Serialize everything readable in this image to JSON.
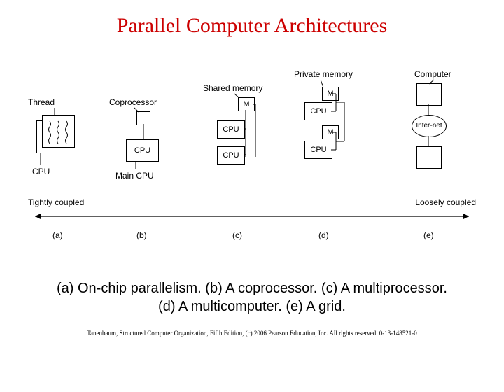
{
  "title": "Parallel Computer Architectures",
  "labels": {
    "thread": "Thread",
    "coprocessor": "Coprocessor",
    "main_cpu": "Main CPU",
    "shared_memory": "Shared memory",
    "private_memory": "Private memory",
    "computer": "Computer",
    "internet": "Inter-net",
    "cpu": "CPU",
    "m": "M",
    "tight": "Tightly coupled",
    "loose": "Loosely coupled",
    "a": "(a)",
    "b": "(b)",
    "c": "(c)",
    "d": "(d)",
    "e": "(e)"
  },
  "caption_line1": "(a) On-chip parallelism. (b) A coprocessor. (c) A multiprocessor.",
  "caption_line2": "(d) A multicomputer. (e) A grid.",
  "copyright": "Tanenbaum, Structured Computer Organization, Fifth Edition, (c) 2006 Pearson Education, Inc. All rights reserved. 0-13-148521-0"
}
